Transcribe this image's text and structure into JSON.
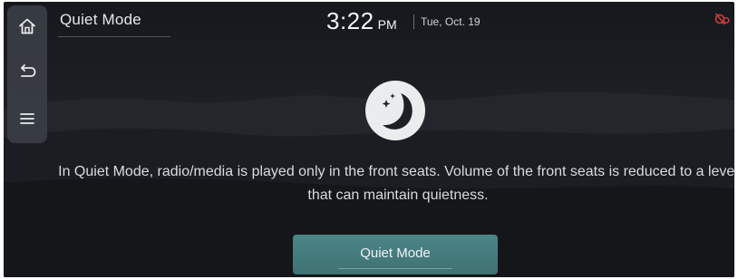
{
  "header": {
    "title": "Quiet Mode"
  },
  "status_bar": {
    "time": "3:22",
    "ampm": "PM",
    "date": "Tue, Oct. 19",
    "status_icon": "mic-off-icon",
    "status_color": "#d23b3b"
  },
  "sidebar": {
    "items": [
      {
        "icon": "home-icon"
      },
      {
        "icon": "back-icon"
      },
      {
        "icon": "menu-icon"
      }
    ]
  },
  "main": {
    "icon": "quiet-mode-moon-icon",
    "message": "In Quiet Mode, radio/media is played only in the front seats. Volume of the front seats is reduced to a level that can maintain quietness.",
    "button_label": "Quiet Mode"
  },
  "colors": {
    "accent": "#457b7c",
    "background": "#1b1f24"
  }
}
